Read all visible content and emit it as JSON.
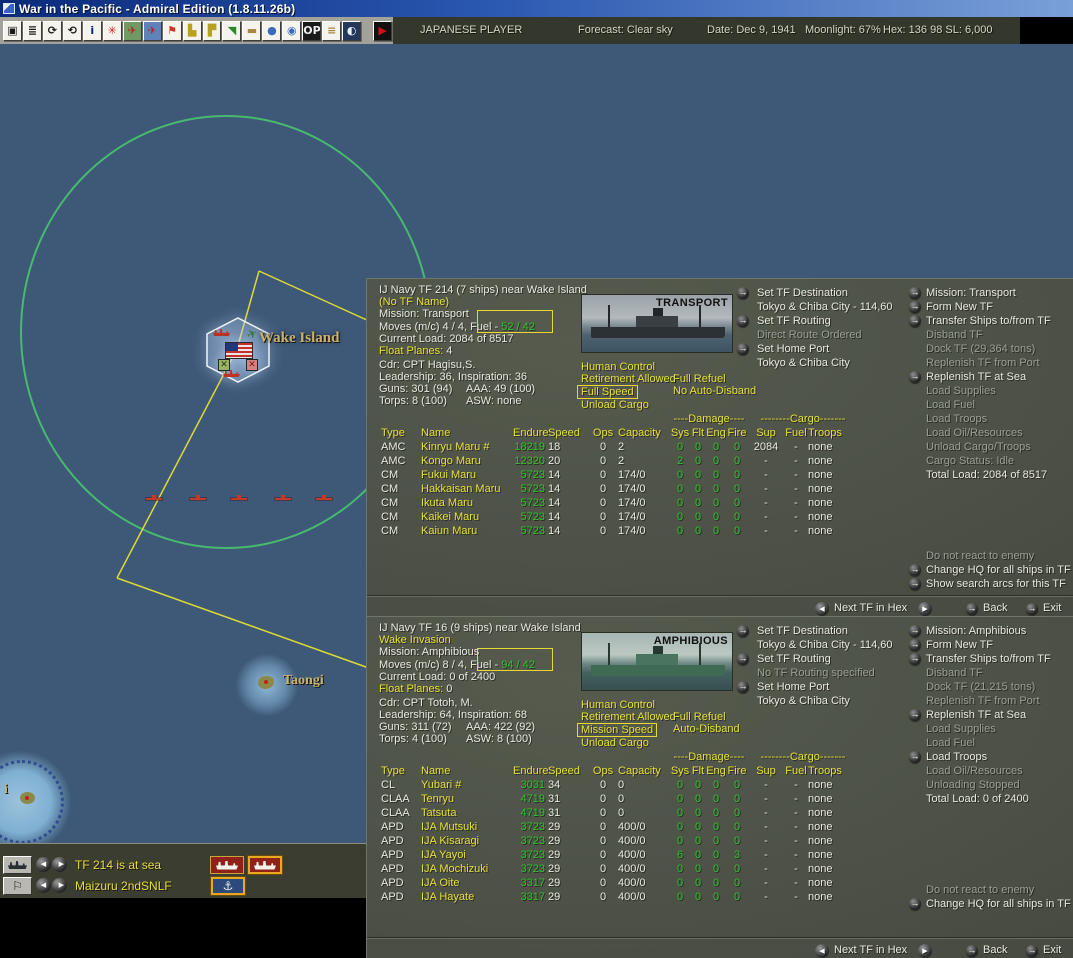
{
  "window": {
    "title": "War in the Pacific - Admiral Edition (1.8.11.26b)"
  },
  "statusbar": {
    "player": "JAPANESE PLAYER",
    "forecast": "Forecast: Clear sky",
    "date": "Date: Dec 9, 1941",
    "moonlight": "Moonlight: 67%",
    "hex": "Hex: 136 98  SL: 6,000"
  },
  "toolbar": {
    "icons": [
      {
        "name": "save-icon",
        "glyph": "▣",
        "fg": "#1a1a1a",
        "bg": "#f4f4ec"
      },
      {
        "name": "report-icon",
        "glyph": "≣",
        "fg": "#1a1a1a",
        "bg": "#f4f4ec"
      },
      {
        "name": "turn-cycle-icon",
        "glyph": "⟳",
        "fg": "#1a1a1a",
        "bg": "#f4f4ec"
      },
      {
        "name": "replay-icon",
        "glyph": "⟲",
        "fg": "#1a1a1a",
        "bg": "#f4f4ec"
      },
      {
        "name": "info-icon",
        "glyph": "i",
        "fg": "#10207a",
        "bg": "#f4f4ec"
      },
      {
        "name": "rising-sun-icon",
        "glyph": "✳",
        "fg": "#cc2222",
        "bg": "#f4f4ec"
      },
      {
        "name": "air-combat-icon",
        "glyph": "✈",
        "fg": "#bb2222",
        "bg": "#6f9a62"
      },
      {
        "name": "air-transfer-icon",
        "glyph": "✈",
        "fg": "#bb2222",
        "bg": "#5f83b8"
      },
      {
        "name": "ground-forces-icon",
        "glyph": "⚑",
        "fg": "#cc3322",
        "bg": "#f4f4ec"
      },
      {
        "name": "naval-forces-icon",
        "glyph": "▙",
        "fg": "#b8a020",
        "bg": "#f4f4ec"
      },
      {
        "name": "task-force-icon",
        "glyph": "▛",
        "fg": "#b8a020",
        "bg": "#f4f4ec"
      },
      {
        "name": "industry-icon",
        "glyph": "◥",
        "fg": "#2a8a2a",
        "bg": "#f4f4ec"
      },
      {
        "name": "transport-icon",
        "glyph": "▬",
        "fg": "#a8864a",
        "bg": "#f4f4ec"
      },
      {
        "name": "world-map-icon",
        "glyph": "●",
        "fg": "#3a6abc",
        "bg": "#f4f4ec"
      },
      {
        "name": "zoom-map-icon",
        "glyph": "◉",
        "fg": "#3a6abc",
        "bg": "#f4f4ec"
      },
      {
        "name": "operations-icon",
        "glyph": "OP",
        "fg": "#f0f0f0",
        "bg": "#1a1a1a"
      },
      {
        "name": "railroad-icon",
        "glyph": "≡",
        "fg": "#a8864a",
        "bg": "#f4f4ec"
      },
      {
        "name": "weather-icon",
        "glyph": "◐",
        "fg": "#e8f0f8",
        "bg": "#24365a"
      },
      {
        "name": "run-turn-icon",
        "glyph": "▶",
        "fg": "#cc1111",
        "bg": "#101010",
        "gap": true
      }
    ]
  },
  "map": {
    "wake_label": "Wake Island",
    "taongi_label": "Taongi",
    "edge_label": "i",
    "hex_icons": [
      "enemy-ship-icon",
      "friendly-plane-icon",
      "friendly-base-icon",
      "enemy-base-icon",
      "enemy-ship-icon",
      "us-flag-icon"
    ]
  },
  "tf_bar": {
    "rows": [
      {
        "label": "TF 214 is at sea"
      },
      {
        "label": "Maizuru 2ndSNLF"
      }
    ]
  },
  "colors": {
    "text_yellow": "#e6e03a",
    "text_green": "#2ec22e",
    "text_white": "#e9e9e1",
    "text_gray": "#9aa096",
    "highlight_box": "#e8d832",
    "panel_bg": "#4c5045",
    "map_sea": "#3e5878",
    "range_circle": "#48c56e",
    "route_line": "#e6e232"
  },
  "panels": [
    {
      "title": "IJ Navy TF 214 (7 ships)  near Wake Island",
      "tf_name": "(No TF Name)",
      "mission": "Mission: Transport",
      "moves_prefix": "Moves (m/c)  4 / 4, Fuel - ",
      "fuel_value": "52 / 42",
      "load": "Current Load: 2084 of 8517",
      "float_planes_label": "Float Planes:",
      "float_planes_value": " 4",
      "cdr": "Cdr: CPT  Hagisu,S.",
      "leadership": "Leadership: 36, Inspiration: 36",
      "guns": "Guns: 301 (94)",
      "aaa": "AAA: 49 (100)",
      "torps": "Torps: 8 (100)",
      "asw": "ASW: none",
      "image_label": "TRANSPORT",
      "image_kind": "transport",
      "toggles": [
        "Human Control",
        "Retirement Allowed",
        "Full Speed",
        "Unload Cargo"
      ],
      "boxed_toggle_index": 2,
      "toggles_right": [
        "Full Refuel",
        "No Auto-Disband"
      ],
      "nav": [
        {
          "label": "Set TF Destination",
          "arrow": true,
          "state": "active"
        },
        {
          "label": "Tokyo & Chiba City - 114,60",
          "state": "active"
        },
        {
          "label": "Set TF Routing",
          "arrow": true,
          "state": "active"
        },
        {
          "label": "Direct Route Ordered",
          "state": "disabled"
        },
        {
          "label": "Set Home Port",
          "arrow": true,
          "state": "active"
        },
        {
          "label": "Tokyo & Chiba City",
          "state": "active"
        }
      ],
      "actions": [
        {
          "label": "Mission: Transport",
          "arrow": true,
          "state": "active"
        },
        {
          "label": "Form New TF",
          "arrow": true,
          "state": "active"
        },
        {
          "label": "Transfer Ships to/from TF",
          "arrow": true,
          "state": "active"
        },
        {
          "label": "Disband TF",
          "state": "disabled"
        },
        {
          "label": "Dock TF (29,364 tons)",
          "state": "disabled"
        },
        {
          "label": "Replenish TF from Port",
          "state": "disabled"
        },
        {
          "label": "Replenish TF at Sea",
          "arrow": true,
          "state": "active"
        },
        {
          "label": "Load Supplies",
          "state": "disabled"
        },
        {
          "label": "Load Fuel",
          "state": "disabled"
        },
        {
          "label": "Load Troops",
          "state": "disabled"
        },
        {
          "label": "Load Oil/Resources",
          "state": "disabled"
        },
        {
          "label": "Unload Cargo/Troops",
          "state": "disabled"
        },
        {
          "label": "Cargo Status: Idle",
          "state": "disabled"
        },
        {
          "label": "Total Load: 2084 of 8517",
          "state": "active"
        }
      ],
      "react": [
        {
          "label": "Do not react to enemy",
          "state": "disabled"
        },
        {
          "label": "Change HQ for all ships in TF",
          "arrow": true,
          "state": "active"
        },
        {
          "label": "Show search arcs for this TF",
          "arrow": true,
          "state": "active"
        }
      ],
      "table": {
        "group_damage": "----Damage----",
        "group_cargo": "--------Cargo-------",
        "headers": [
          "Type",
          "Name",
          "Endure",
          "Speed",
          "Ops",
          "Capacity",
          "Sys",
          "Flt",
          "Eng",
          "Fire",
          "Sup",
          "Fuel",
          "Troops"
        ],
        "rows": [
          [
            "AMC",
            "Kinryu Maru #",
            "18219",
            "18",
            "0",
            "2",
            "0",
            "0",
            "0",
            "0",
            "2084",
            "-",
            "none"
          ],
          [
            "AMC",
            "Kongo Maru",
            "12320",
            "20",
            "0",
            "2",
            "2",
            "0",
            "0",
            "0",
            "-",
            "-",
            "none"
          ],
          [
            "CM",
            "Fukui Maru",
            "5723",
            "14",
            "0",
            "174/0",
            "0",
            "0",
            "0",
            "0",
            "-",
            "-",
            "none"
          ],
          [
            "CM",
            "Hakkaisan Maru",
            "5723",
            "14",
            "0",
            "174/0",
            "0",
            "0",
            "0",
            "0",
            "-",
            "-",
            "none"
          ],
          [
            "CM",
            "Ikuta Maru",
            "5723",
            "14",
            "0",
            "174/0",
            "0",
            "0",
            "0",
            "0",
            "-",
            "-",
            "none"
          ],
          [
            "CM",
            "Kaikei Maru",
            "5723",
            "14",
            "0",
            "174/0",
            "0",
            "0",
            "0",
            "0",
            "-",
            "-",
            "none"
          ],
          [
            "CM",
            "Kaiun Maru",
            "5723",
            "14",
            "0",
            "174/0",
            "0",
            "0",
            "0",
            "0",
            "-",
            "-",
            "none"
          ]
        ]
      },
      "footer": {
        "next_label": "Next TF in Hex",
        "back": "Back",
        "exit": "Exit"
      }
    },
    {
      "title": "IJ Navy TF 16 (9 ships)  near Wake Island",
      "tf_name": "Wake Invasion",
      "mission": "Mission: Amphibious",
      "moves_prefix": "Moves (m/c)  8 / 4, Fuel - ",
      "fuel_value": "94 / 42",
      "load": "Current Load: 0 of 2400",
      "float_planes_label": "Float Planes:",
      "float_planes_value": " 0",
      "cdr": "Cdr: CPT  Totoh, M.",
      "leadership": "Leadership: 64, Inspiration: 68",
      "guns": "Guns: 311 (72)",
      "aaa": "AAA: 422 (92)",
      "torps": "Torps: 4 (100)",
      "asw": "ASW: 8 (100)",
      "image_label": "AMPHIBIOUS",
      "image_kind": "amphibious",
      "toggles": [
        "Human Control",
        "Retirement Allowed",
        "Mission Speed",
        "Unload Cargo"
      ],
      "boxed_toggle_index": 2,
      "toggles_right": [
        "Full Refuel",
        "Auto-Disband"
      ],
      "nav": [
        {
          "label": "Set TF Destination",
          "arrow": true,
          "state": "active"
        },
        {
          "label": "Tokyo & Chiba City - 114,60",
          "state": "active"
        },
        {
          "label": "Set TF Routing",
          "arrow": true,
          "state": "active"
        },
        {
          "label": "No TF Routing specified",
          "state": "disabled"
        },
        {
          "label": "Set Home Port",
          "arrow": true,
          "state": "active"
        },
        {
          "label": "Tokyo & Chiba City",
          "state": "active"
        }
      ],
      "actions": [
        {
          "label": "Mission: Amphibious",
          "arrow": true,
          "state": "active"
        },
        {
          "label": "Form New TF",
          "arrow": true,
          "state": "active"
        },
        {
          "label": "Transfer Ships to/from TF",
          "arrow": true,
          "state": "active"
        },
        {
          "label": "Disband TF",
          "state": "disabled"
        },
        {
          "label": "Dock TF (21,215 tons)",
          "state": "disabled"
        },
        {
          "label": "Replenish TF from Port",
          "state": "disabled"
        },
        {
          "label": "Replenish TF at Sea",
          "arrow": true,
          "state": "active"
        },
        {
          "label": "Load Supplies",
          "state": "disabled"
        },
        {
          "label": "Load Fuel",
          "state": "disabled"
        },
        {
          "label": "Load Troops",
          "arrow": true,
          "state": "active"
        },
        {
          "label": "Load Oil/Resources",
          "state": "disabled"
        },
        {
          "label": "Unloading Stopped",
          "state": "disabled"
        },
        {
          "label": "Total Load: 0 of 2400",
          "state": "active"
        }
      ],
      "react": [
        {
          "label": "Do not react to enemy",
          "state": "disabled"
        },
        {
          "label": "Change HQ for all ships in TF",
          "arrow": true,
          "state": "active"
        }
      ],
      "table": {
        "group_damage": "----Damage----",
        "group_cargo": "--------Cargo-------",
        "headers": [
          "Type",
          "Name",
          "Endure",
          "Speed",
          "Ops",
          "Capacity",
          "Sys",
          "Flt",
          "Eng",
          "Fire",
          "Sup",
          "Fuel",
          "Troops"
        ],
        "rows": [
          [
            "CL",
            "Yubari #",
            "3031",
            "34",
            "0",
            "0",
            "0",
            "0",
            "0",
            "0",
            "-",
            "-",
            "none"
          ],
          [
            "CLAA",
            "Tenryu",
            "4719",
            "31",
            "0",
            "0",
            "0",
            "0",
            "0",
            "0",
            "-",
            "-",
            "none"
          ],
          [
            "CLAA",
            "Tatsuta",
            "4719",
            "31",
            "0",
            "0",
            "0",
            "0",
            "0",
            "0",
            "-",
            "-",
            "none"
          ],
          [
            "APD",
            "IJA Mutsuki",
            "3723",
            "29",
            "0",
            "400/0",
            "0",
            "0",
            "0",
            "0",
            "-",
            "-",
            "none"
          ],
          [
            "APD",
            "IJA Kisaragi",
            "3723",
            "29",
            "0",
            "400/0",
            "0",
            "0",
            "0",
            "0",
            "-",
            "-",
            "none"
          ],
          [
            "APD",
            "IJA Yayoi",
            "3723",
            "29",
            "0",
            "400/0",
            "6",
            "0",
            "0",
            "3",
            "-",
            "-",
            "none"
          ],
          [
            "APD",
            "IJA Mochizuki",
            "3723",
            "29",
            "0",
            "400/0",
            "0",
            "0",
            "0",
            "0",
            "-",
            "-",
            "none"
          ],
          [
            "APD",
            "IJA Oite",
            "3317",
            "29",
            "0",
            "400/0",
            "0",
            "0",
            "0",
            "0",
            "-",
            "-",
            "none"
          ],
          [
            "APD",
            "IJA Hayate",
            "3317",
            "29",
            "0",
            "400/0",
            "0",
            "0",
            "0",
            "0",
            "-",
            "-",
            "none"
          ]
        ]
      },
      "footer": {
        "next_label": "Next TF in Hex",
        "back": "Back",
        "exit": "Exit"
      }
    }
  ]
}
